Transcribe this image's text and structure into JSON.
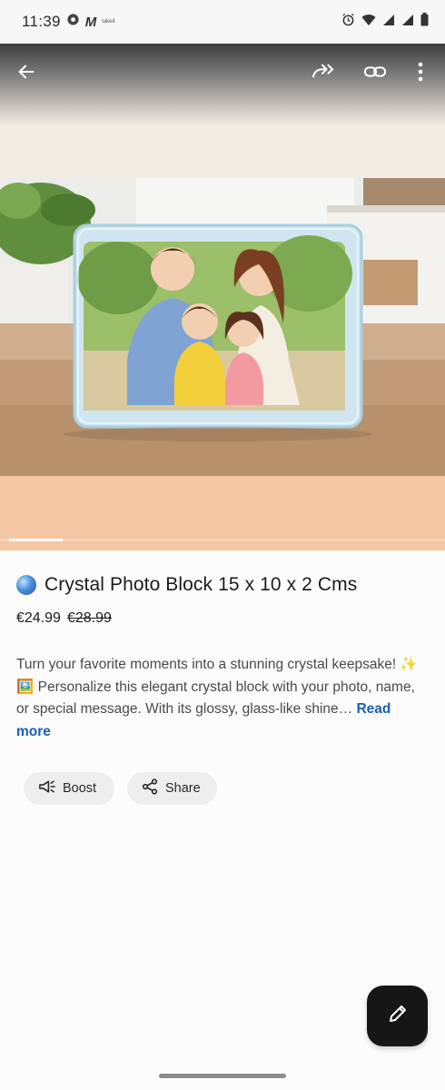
{
  "status_bar": {
    "time": "11:39",
    "app_icon": "m-logo",
    "small_text": "takeit"
  },
  "top_bar": {
    "back_icon": "arrow-left-icon",
    "forward_icon": "share-forward-icon",
    "link_icon": "link-icon",
    "menu_icon": "more-vertical-icon"
  },
  "media": {
    "image_subject": "crystal photo block with family illustration",
    "carousel_progress": 0.12
  },
  "product": {
    "title": "Crystal Photo Block 15 x 10 x 2 Cms",
    "price": "€24.99",
    "old_price": "€28.99",
    "description": "Turn your favorite moments into a stunning crystal keepsake! ✨🖼️ Personalize this elegant crystal block with your photo, name, or special message. With its glossy, glass-like shine…",
    "read_more": "Read more"
  },
  "actions": {
    "boost_label": "Boost",
    "share_label": "Share"
  },
  "fab": {
    "icon": "pencil-icon"
  },
  "colors": {
    "accent_link": "#1a5fb4",
    "fab_bg": "#161616",
    "chip_bg": "#efeeee",
    "peach": "#f5c6a4"
  }
}
